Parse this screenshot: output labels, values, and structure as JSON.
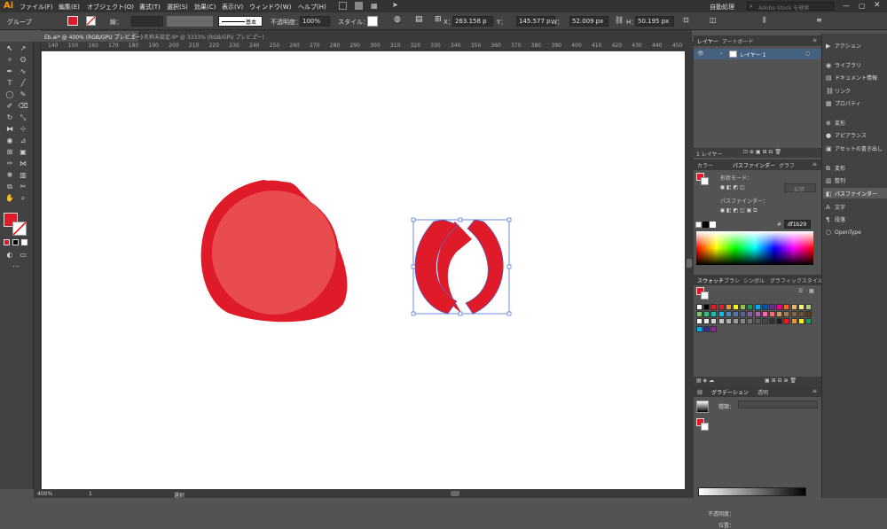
{
  "app": {
    "logo": "Ai",
    "menu": [
      "ファイル(F)",
      "編集(E)",
      "オブジェクト(O)",
      "書式(T)",
      "選択(S)",
      "効果(C)",
      "表示(V)",
      "ウィンドウ(W)",
      "ヘルプ(H)"
    ],
    "workspace": "自動処理",
    "search_placeholder": "Adobe Stock を検索"
  },
  "control_bar": {
    "selection_label": "グループ",
    "stroke_label": "線：",
    "stroke_style": "基本",
    "opacity_label": "不透明度：",
    "opacity_value": "100%",
    "style_label": "スタイル：",
    "x_label": "X：",
    "x_value": "263.158 p",
    "y_label": "Y：",
    "y_value": "145.577 p",
    "w_label": "W：",
    "w_value": "52.009 px",
    "h_label": "H：",
    "h_value": "50.195 px"
  },
  "tabs": [
    {
      "label": "Eb.ai* @ 400% (RGB/GPU プレビュー)",
      "active": true
    },
    {
      "label": "名称未設定-9* @ 3333% (RGB/GPU プレビュー)",
      "active": false
    }
  ],
  "ruler_ticks": [
    "140",
    "150",
    "160",
    "170",
    "180",
    "190",
    "200",
    "210",
    "220",
    "230",
    "240",
    "250",
    "260",
    "270",
    "280",
    "290",
    "300",
    "310",
    "320",
    "330",
    "340",
    "350",
    "360",
    "370",
    "380",
    "390",
    "400",
    "410",
    "420",
    "430",
    "440",
    "450"
  ],
  "status": {
    "zoom": "400%",
    "page": "1",
    "tool": "選択"
  },
  "layers_panel": {
    "tabs": [
      "レイヤー",
      "アートボード"
    ],
    "layer_name": "レイヤー 1",
    "footer": "1 レイヤー"
  },
  "pathfinder_panel": {
    "tabs": [
      "カラー",
      "パスファインダー",
      "グラフ"
    ],
    "shape_mode_label": "形状モード：",
    "expand_label": "拡張",
    "pathfinders_label": "パスファインダー：",
    "hex_value": "df1b29"
  },
  "swatches_panel": {
    "tabs": [
      "スウォッチ",
      "ブラシ",
      "シンボル",
      "グラフィックスタイル"
    ],
    "colors": [
      "#ffffff",
      "#000000",
      "#df1b29",
      "#ed1c24",
      "#f7941d",
      "#fff200",
      "#8dc63f",
      "#00a651",
      "#00aeef",
      "#0054a6",
      "#662d91",
      "#ec008c",
      "#f26522",
      "#fbaf5d",
      "#fff568",
      "#acd373",
      "#7cc576",
      "#3cb878",
      "#1cbbb4",
      "#00bff3",
      "#448ccb",
      "#5674b9",
      "#605ca8",
      "#855fa8",
      "#a864a8",
      "#f06eaa",
      "#f26d7d",
      "#c69c6d",
      "#a67c52",
      "#8c6239",
      "#754c24",
      "#603913",
      "#ffffff",
      "#ebebeb",
      "#d7d7d7",
      "#c2c2c2",
      "#adadad",
      "#999999",
      "#858585",
      "#707070",
      "#5c5c5c",
      "#474747",
      "#333333",
      "#1f1f1f",
      "#ed1c24",
      "#f7941d",
      "#fff200",
      "#00a651",
      "#00aeef",
      "#2e3192",
      "#92278f"
    ]
  },
  "gradient_panel": {
    "tabs": [
      "線",
      "グラデーション",
      "透明"
    ],
    "type_label": "種類：",
    "opacity_label": "不透明度：",
    "location_label": "位置："
  },
  "right_bar": {
    "items": [
      {
        "icon": "play-icon",
        "label": "アクション"
      },
      {
        "icon": "library-icon",
        "label": "ライブラリ"
      },
      {
        "icon": "info-icon",
        "label": "ドキュメント情報"
      },
      {
        "icon": "link-icon",
        "label": "リンク"
      },
      {
        "icon": "properties-icon",
        "label": "プロパティ"
      },
      {
        "icon": "transform-icon",
        "label": "変形"
      },
      {
        "icon": "appearance-icon",
        "label": "アピアランス"
      },
      {
        "icon": "export-icon",
        "label": "アセットの書き出し"
      },
      {
        "icon": "transform2-icon",
        "label": "変形"
      },
      {
        "icon": "align-icon",
        "label": "整列"
      },
      {
        "icon": "pathfinder-icon",
        "label": "パスファインダー"
      },
      {
        "icon": "character-icon",
        "label": "文字"
      },
      {
        "icon": "paragraph-icon",
        "label": "段落"
      },
      {
        "icon": "opentype-icon",
        "label": "OpenType"
      }
    ]
  },
  "colors": {
    "art_dark": "#df1b29",
    "art_light": "#e84c4f",
    "selection": "#4a6cd4"
  }
}
